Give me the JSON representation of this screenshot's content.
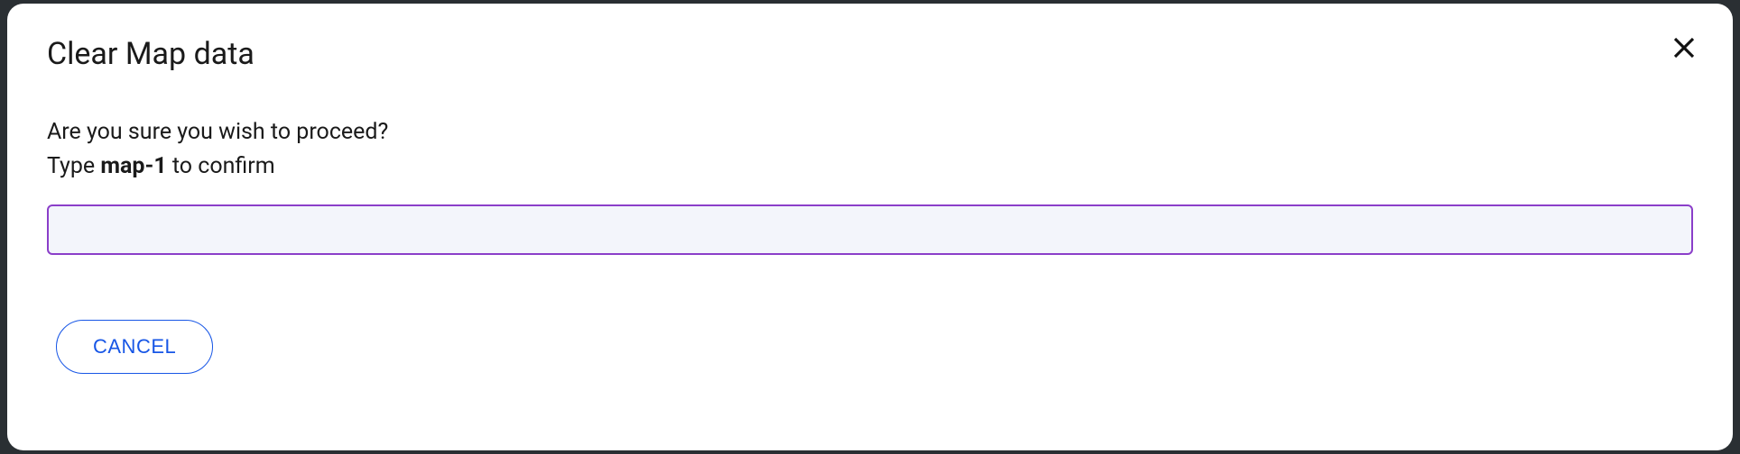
{
  "modal": {
    "title": "Clear Map data",
    "question": "Are you sure you wish to proceed?",
    "type_prefix": "Type ",
    "confirm_key": "map-1",
    "type_suffix": " to confirm",
    "input_value": "",
    "cancel_label": "CANCEL"
  }
}
